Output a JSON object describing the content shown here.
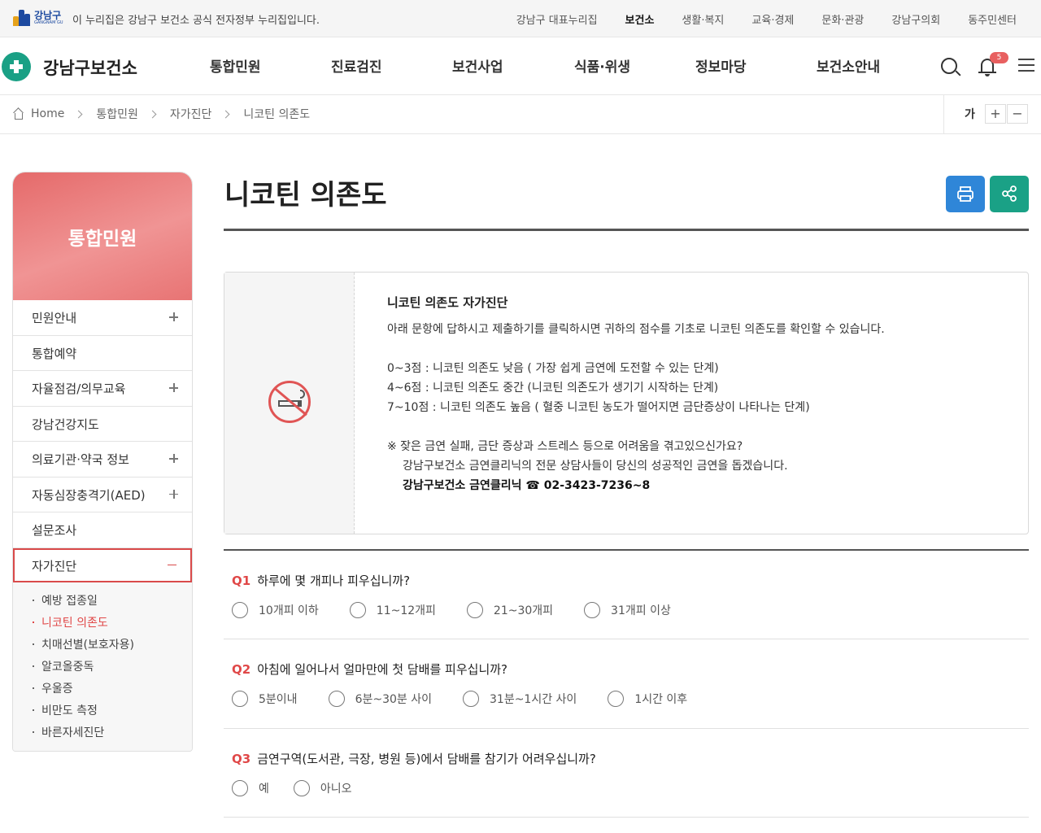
{
  "topbar": {
    "gov_logo_text": "강남구",
    "gov_logo_sub": "GANGNAM GU",
    "official_notice": "이 누리집은 강남구 보건소 공식 전자정부 누리집입니다.",
    "links": [
      "강남구 대표누리집",
      "보건소",
      "생활·복지",
      "교육·경제",
      "문화·관광",
      "강남구의회",
      "동주민센터"
    ]
  },
  "header": {
    "site_name": "강남구보건소",
    "nav": [
      "통합민원",
      "진료검진",
      "보건사업",
      "식품·위생",
      "정보마당",
      "보건소안내"
    ],
    "notification_count": "5"
  },
  "breadcrumb": {
    "items": [
      "Home",
      "통합민원",
      "자가진단",
      "니코틴 의존도"
    ]
  },
  "font_control": {
    "label": "가",
    "increase": "+",
    "decrease": "−"
  },
  "sidebar": {
    "title": "통합민원",
    "items": [
      {
        "label": "민원안내"
      },
      {
        "label": "통합예약"
      },
      {
        "label": "자율점검/의무교육"
      },
      {
        "label": "강남건강지도"
      },
      {
        "label": "의료기관·약국 정보"
      },
      {
        "label": "자동심장충격기(AED)"
      },
      {
        "label": "설문조사"
      },
      {
        "label": "자가진단"
      }
    ],
    "sub_items": [
      "예방 접종일",
      "니코틴 의존도",
      "치매선별(보호자용)",
      "알코올중독",
      "우울증",
      "비만도 측정",
      "바른자세진단"
    ]
  },
  "main": {
    "title": "니코틴 의존도",
    "info": {
      "heading": "니코틴 의존도 자가진단",
      "intro": "아래 문항에 답하시고 제출하기를 클릭하시면 귀하의 점수를 기초로 니코틴 의존도를 확인할 수 있습니다.",
      "levels": [
        "0~3점 : 니코틴 의존도 낮음 ( 가장 쉽게 금연에 도전할 수 있는 단계)",
        "4~6점 :  니코틴 의존도 중간 (니코틴 의존도가 생기기 시작하는 단계)",
        "7~10점 : 니코틴 의존도 높음 ( 혈중 니코틴 농도가 떨어지면 금단증상이 나타나는 단계)"
      ],
      "note": "※ 잦은 금연 실패, 금단 증상과 스트레스 등으로 어려움을 겪고있으신가요?",
      "note2": "강남구보건소 금연클리닉의 전문 상담사들이 당신의 성공적인 금연을 돕겠습니다.",
      "contact": "강남구보건소 금연클리닉 ☎ 02-3423-7236~8"
    },
    "questions": [
      {
        "num": "Q1",
        "text": "하루에 몇 개피나 피우십니까?",
        "options": [
          "10개피 이하",
          "11~12개피",
          "21~30개피",
          "31개피 이상"
        ]
      },
      {
        "num": "Q2",
        "text": "아침에 일어나서 얼마만에 첫 담배를 피우십니까?",
        "options": [
          "5분이내",
          "6분~30분 사이",
          "31분~1시간 사이",
          "1시간 이후"
        ]
      },
      {
        "num": "Q3",
        "text": "금연구역(도서관, 극장, 병원 등)에서 담배를 참기가 어려우십니까?",
        "options": [
          "예",
          "아니오"
        ]
      }
    ]
  }
}
